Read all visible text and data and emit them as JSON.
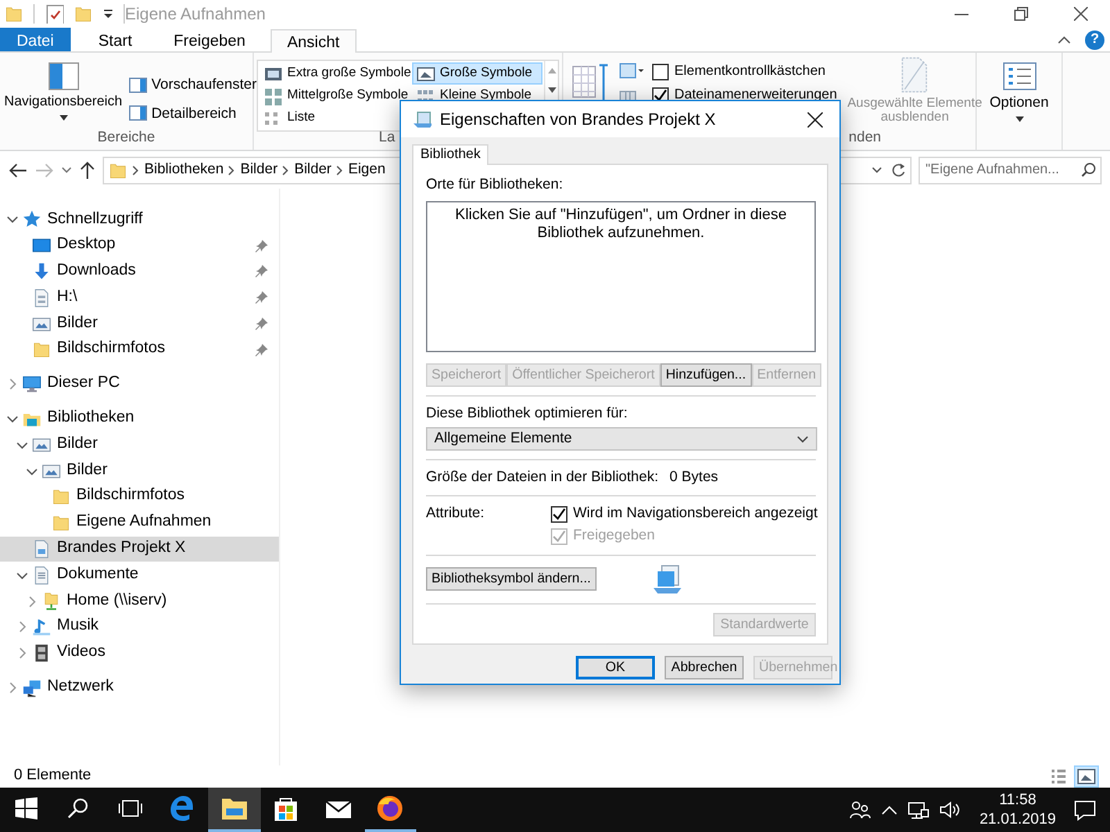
{
  "window": {
    "title": "Eigene Aufnahmen",
    "help_label": "?"
  },
  "ribbon_tabs": [
    {
      "label": "Datei",
      "kind": "file",
      "selected": false
    },
    {
      "label": "Start",
      "kind": "tab",
      "selected": false
    },
    {
      "label": "Freigeben",
      "kind": "tab",
      "selected": false
    },
    {
      "label": "Ansicht",
      "kind": "tab",
      "selected": true
    }
  ],
  "ribbon": {
    "panes": {
      "label": "Bereiche",
      "large_button": "Navigationsbereich",
      "buttons": [
        "Vorschaufenster",
        "Detailbereich"
      ]
    },
    "layout": {
      "label": "La",
      "options": [
        {
          "label": "Extra große Symbole",
          "kind": "xl",
          "selected": false
        },
        {
          "label": "Große Symbole",
          "kind": "large",
          "selected": true
        },
        {
          "label": "Mittelgroße Symbole",
          "kind": "medium",
          "selected": false
        },
        {
          "label": "Kleine Symbole",
          "kind": "small",
          "selected": false
        },
        {
          "label": "Liste",
          "kind": "list",
          "selected": false
        }
      ]
    },
    "show_hide": {
      "label": "nden",
      "checkboxes": [
        {
          "label": "Elementkontrollkästchen",
          "checked": false
        },
        {
          "label": "Dateinamenerweiterungen",
          "checked": true
        }
      ],
      "hide_button": {
        "label": "Ausgewählte Elemente ausblenden",
        "disabled": true
      }
    },
    "options": {
      "label": "Optionen"
    }
  },
  "address_bar": {
    "breadcrumbs": [
      "Bibliotheken",
      "Bilder",
      "Bilder",
      "Eigen"
    ],
    "search_placeholder": "\"Eigene Aufnahmen..."
  },
  "nav_tree": [
    {
      "label": "Schnellzugriff",
      "kind": "quick",
      "expanded": true,
      "selected": false,
      "children": [
        {
          "label": "Desktop",
          "kind": "desktop",
          "pinned": true,
          "selected": false
        },
        {
          "label": "Downloads",
          "kind": "downloads",
          "pinned": true,
          "selected": false
        },
        {
          "label": "H:\\",
          "kind": "drive",
          "pinned": true,
          "selected": false
        },
        {
          "label": "Bilder",
          "kind": "pictures",
          "pinned": true,
          "selected": false
        },
        {
          "label": "Bildschirmfotos",
          "kind": "folder",
          "pinned": true,
          "selected": false
        }
      ]
    },
    {
      "label": "Dieser PC",
      "kind": "pc",
      "expanded": false,
      "selected": false
    },
    {
      "label": "Bibliotheken",
      "kind": "libraries",
      "expanded": true,
      "selected": false,
      "children": [
        {
          "label": "Bilder",
          "kind": "pictures",
          "expanded": true,
          "selected": false,
          "children": [
            {
              "label": "Bilder",
              "kind": "pictures",
              "expanded": true,
              "selected": false,
              "children": [
                {
                  "label": "Bildschirmfotos",
                  "kind": "folder",
                  "selected": false
                },
                {
                  "label": "Eigene Aufnahmen",
                  "kind": "folder",
                  "selected": false
                }
              ]
            }
          ]
        },
        {
          "label": "Brandes Projekt X",
          "kind": "library",
          "selected": true
        },
        {
          "label": "Dokumente",
          "kind": "documents",
          "expanded": true,
          "selected": false,
          "children": [
            {
              "label": "Home (\\\\iserv)",
              "kind": "netfolder",
              "expanded": false,
              "selected": false
            }
          ]
        },
        {
          "label": "Musik",
          "kind": "music",
          "expanded": false,
          "selected": false
        },
        {
          "label": "Videos",
          "kind": "videos",
          "expanded": false,
          "selected": false
        }
      ]
    },
    {
      "label": "Netzwerk",
      "kind": "network",
      "expanded": false,
      "selected": false
    }
  ],
  "status_bar": {
    "item_count": "0 Elemente",
    "views": [
      {
        "kind": "details",
        "selected": false
      },
      {
        "kind": "large_icons",
        "selected": true
      }
    ]
  },
  "dialog": {
    "title": "Eigenschaften von Brandes Projekt X",
    "tabs": [
      {
        "label": "Bibliothek",
        "selected": true
      }
    ],
    "locations_label": "Orte für Bibliotheken:",
    "empty_message": "Klicken Sie auf \"Hinzufügen\", um Ordner in diese Bibliothek aufzunehmen.",
    "location_buttons": [
      {
        "label": "Speicherort",
        "disabled": true
      },
      {
        "label": "Öffentlicher Speicherort",
        "disabled": true
      },
      {
        "label": "Hinzufügen...",
        "disabled": false
      },
      {
        "label": "Entfernen",
        "disabled": true
      }
    ],
    "optimize_label": "Diese Bibliothek optimieren für:",
    "optimize_value": "Allgemeine Elemente",
    "size_label": "Größe der Dateien in der Bibliothek:",
    "size_value": "0 Bytes",
    "attributes_label": "Attribute:",
    "attributes": [
      {
        "label": "Wird im Navigationsbereich angezeigt",
        "checked": true,
        "disabled": false
      },
      {
        "label": "Freigegeben",
        "checked": true,
        "disabled": true
      }
    ],
    "change_icon_button": "Bibliotheksymbol ändern...",
    "restore_button": {
      "label": "Standardwerte",
      "disabled": true
    },
    "footer_buttons": [
      {
        "label": "OK",
        "default": true,
        "disabled": false
      },
      {
        "label": "Abbrechen",
        "default": false,
        "disabled": false
      },
      {
        "label": "Übernehmen",
        "default": false,
        "disabled": true
      }
    ]
  },
  "taskbar": {
    "apps": [
      {
        "kind": "edge",
        "running": false,
        "selected": false
      },
      {
        "kind": "explorer",
        "running": true,
        "selected": true
      },
      {
        "kind": "store",
        "running": false,
        "selected": false
      },
      {
        "kind": "mail",
        "running": false,
        "selected": false
      },
      {
        "kind": "firefox",
        "running": true,
        "selected": false
      }
    ],
    "time": "11:58",
    "date": "21.01.2019"
  }
}
